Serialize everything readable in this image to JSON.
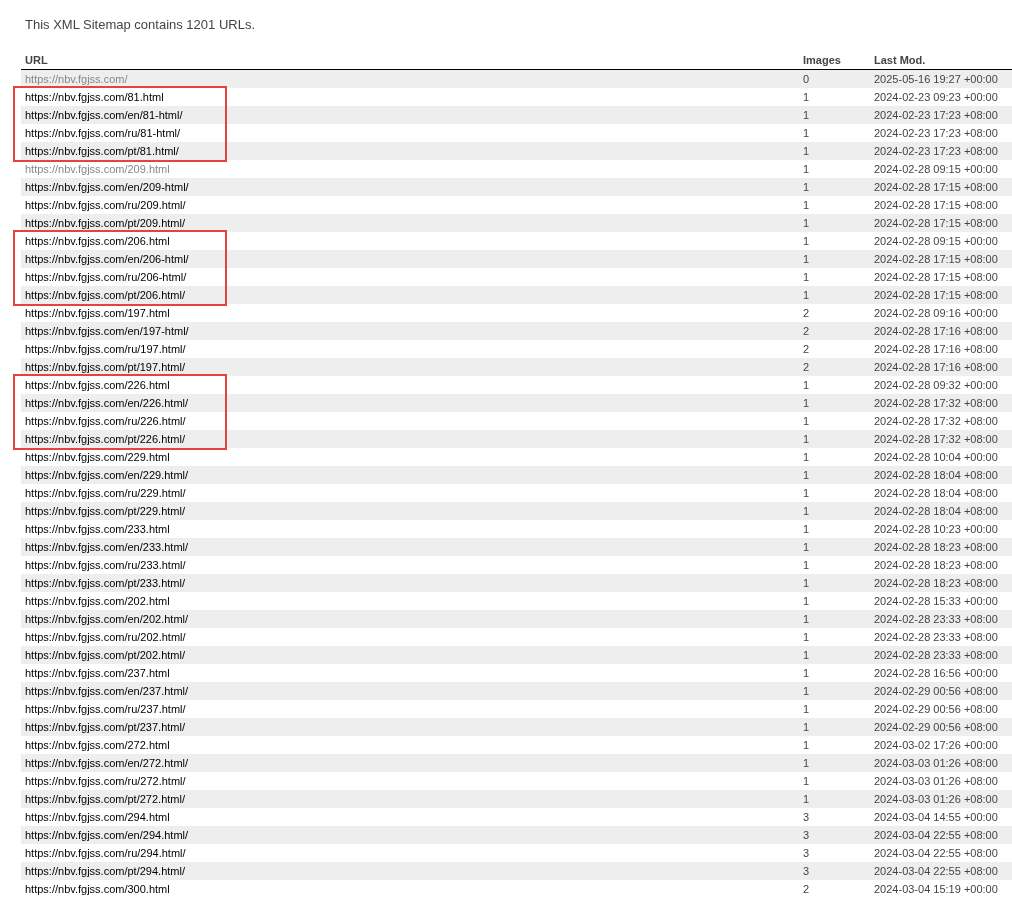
{
  "intro": "This XML Sitemap contains 1201 URLs.",
  "columns": [
    "URL",
    "Images",
    "Last Mod."
  ],
  "rows": [
    {
      "url": "https://nbv.fgjss.com/",
      "images": "0",
      "lastmod": "2025-05-16 19:27 +00:00",
      "visited": true,
      "highlighted": false
    },
    {
      "url": "https://nbv.fgjss.com/81.html",
      "images": "1",
      "lastmod": "2024-02-23 09:23 +00:00",
      "visited": false,
      "highlighted": true
    },
    {
      "url": "https://nbv.fgjss.com/en/81-html/",
      "images": "1",
      "lastmod": "2024-02-23 17:23 +08:00",
      "visited": false,
      "highlighted": true
    },
    {
      "url": "https://nbv.fgjss.com/ru/81-html/",
      "images": "1",
      "lastmod": "2024-02-23 17:23 +08:00",
      "visited": false,
      "highlighted": true
    },
    {
      "url": "https://nbv.fgjss.com/pt/81.html/",
      "images": "1",
      "lastmod": "2024-02-23 17:23 +08:00",
      "visited": false,
      "highlighted": true
    },
    {
      "url": "https://nbv.fgjss.com/209.html",
      "images": "1",
      "lastmod": "2024-02-28 09:15 +00:00",
      "visited": true,
      "highlighted": false
    },
    {
      "url": "https://nbv.fgjss.com/en/209-html/",
      "images": "1",
      "lastmod": "2024-02-28 17:15 +08:00",
      "visited": false,
      "highlighted": false
    },
    {
      "url": "https://nbv.fgjss.com/ru/209.html/",
      "images": "1",
      "lastmod": "2024-02-28 17:15 +08:00",
      "visited": false,
      "highlighted": false
    },
    {
      "url": "https://nbv.fgjss.com/pt/209.html/",
      "images": "1",
      "lastmod": "2024-02-28 17:15 +08:00",
      "visited": false,
      "highlighted": false
    },
    {
      "url": "https://nbv.fgjss.com/206.html",
      "images": "1",
      "lastmod": "2024-02-28 09:15 +00:00",
      "visited": false,
      "highlighted": true
    },
    {
      "url": "https://nbv.fgjss.com/en/206-html/",
      "images": "1",
      "lastmod": "2024-02-28 17:15 +08:00",
      "visited": false,
      "highlighted": true
    },
    {
      "url": "https://nbv.fgjss.com/ru/206-html/",
      "images": "1",
      "lastmod": "2024-02-28 17:15 +08:00",
      "visited": false,
      "highlighted": true
    },
    {
      "url": "https://nbv.fgjss.com/pt/206.html/",
      "images": "1",
      "lastmod": "2024-02-28 17:15 +08:00",
      "visited": false,
      "highlighted": true
    },
    {
      "url": "https://nbv.fgjss.com/197.html",
      "images": "2",
      "lastmod": "2024-02-28 09:16 +00:00",
      "visited": false,
      "highlighted": false
    },
    {
      "url": "https://nbv.fgjss.com/en/197-html/",
      "images": "2",
      "lastmod": "2024-02-28 17:16 +08:00",
      "visited": false,
      "highlighted": false
    },
    {
      "url": "https://nbv.fgjss.com/ru/197.html/",
      "images": "2",
      "lastmod": "2024-02-28 17:16 +08:00",
      "visited": false,
      "highlighted": false
    },
    {
      "url": "https://nbv.fgjss.com/pt/197.html/",
      "images": "2",
      "lastmod": "2024-02-28 17:16 +08:00",
      "visited": false,
      "highlighted": false
    },
    {
      "url": "https://nbv.fgjss.com/226.html",
      "images": "1",
      "lastmod": "2024-02-28 09:32 +00:00",
      "visited": false,
      "highlighted": true
    },
    {
      "url": "https://nbv.fgjss.com/en/226.html/",
      "images": "1",
      "lastmod": "2024-02-28 17:32 +08:00",
      "visited": false,
      "highlighted": true
    },
    {
      "url": "https://nbv.fgjss.com/ru/226.html/",
      "images": "1",
      "lastmod": "2024-02-28 17:32 +08:00",
      "visited": false,
      "highlighted": true
    },
    {
      "url": "https://nbv.fgjss.com/pt/226.html/",
      "images": "1",
      "lastmod": "2024-02-28 17:32 +08:00",
      "visited": false,
      "highlighted": true
    },
    {
      "url": "https://nbv.fgjss.com/229.html",
      "images": "1",
      "lastmod": "2024-02-28 10:04 +00:00",
      "visited": false,
      "highlighted": false
    },
    {
      "url": "https://nbv.fgjss.com/en/229.html/",
      "images": "1",
      "lastmod": "2024-02-28 18:04 +08:00",
      "visited": false,
      "highlighted": false
    },
    {
      "url": "https://nbv.fgjss.com/ru/229.html/",
      "images": "1",
      "lastmod": "2024-02-28 18:04 +08:00",
      "visited": false,
      "highlighted": false
    },
    {
      "url": "https://nbv.fgjss.com/pt/229.html/",
      "images": "1",
      "lastmod": "2024-02-28 18:04 +08:00",
      "visited": false,
      "highlighted": false
    },
    {
      "url": "https://nbv.fgjss.com/233.html",
      "images": "1",
      "lastmod": "2024-02-28 10:23 +00:00",
      "visited": false,
      "highlighted": false
    },
    {
      "url": "https://nbv.fgjss.com/en/233.html/",
      "images": "1",
      "lastmod": "2024-02-28 18:23 +08:00",
      "visited": false,
      "highlighted": false
    },
    {
      "url": "https://nbv.fgjss.com/ru/233.html/",
      "images": "1",
      "lastmod": "2024-02-28 18:23 +08:00",
      "visited": false,
      "highlighted": false
    },
    {
      "url": "https://nbv.fgjss.com/pt/233.html/",
      "images": "1",
      "lastmod": "2024-02-28 18:23 +08:00",
      "visited": false,
      "highlighted": false
    },
    {
      "url": "https://nbv.fgjss.com/202.html",
      "images": "1",
      "lastmod": "2024-02-28 15:33 +00:00",
      "visited": false,
      "highlighted": false
    },
    {
      "url": "https://nbv.fgjss.com/en/202.html/",
      "images": "1",
      "lastmod": "2024-02-28 23:33 +08:00",
      "visited": false,
      "highlighted": false
    },
    {
      "url": "https://nbv.fgjss.com/ru/202.html/",
      "images": "1",
      "lastmod": "2024-02-28 23:33 +08:00",
      "visited": false,
      "highlighted": false
    },
    {
      "url": "https://nbv.fgjss.com/pt/202.html/",
      "images": "1",
      "lastmod": "2024-02-28 23:33 +08:00",
      "visited": false,
      "highlighted": false
    },
    {
      "url": "https://nbv.fgjss.com/237.html",
      "images": "1",
      "lastmod": "2024-02-28 16:56 +00:00",
      "visited": false,
      "highlighted": false
    },
    {
      "url": "https://nbv.fgjss.com/en/237.html/",
      "images": "1",
      "lastmod": "2024-02-29 00:56 +08:00",
      "visited": false,
      "highlighted": false
    },
    {
      "url": "https://nbv.fgjss.com/ru/237.html/",
      "images": "1",
      "lastmod": "2024-02-29 00:56 +08:00",
      "visited": false,
      "highlighted": false
    },
    {
      "url": "https://nbv.fgjss.com/pt/237.html/",
      "images": "1",
      "lastmod": "2024-02-29 00:56 +08:00",
      "visited": false,
      "highlighted": false
    },
    {
      "url": "https://nbv.fgjss.com/272.html",
      "images": "1",
      "lastmod": "2024-03-02 17:26 +00:00",
      "visited": false,
      "highlighted": false
    },
    {
      "url": "https://nbv.fgjss.com/en/272.html/",
      "images": "1",
      "lastmod": "2024-03-03 01:26 +08:00",
      "visited": false,
      "highlighted": false
    },
    {
      "url": "https://nbv.fgjss.com/ru/272.html/",
      "images": "1",
      "lastmod": "2024-03-03 01:26 +08:00",
      "visited": false,
      "highlighted": false
    },
    {
      "url": "https://nbv.fgjss.com/pt/272.html/",
      "images": "1",
      "lastmod": "2024-03-03 01:26 +08:00",
      "visited": false,
      "highlighted": false
    },
    {
      "url": "https://nbv.fgjss.com/294.html",
      "images": "3",
      "lastmod": "2024-03-04 14:55 +00:00",
      "visited": false,
      "highlighted": false
    },
    {
      "url": "https://nbv.fgjss.com/en/294.html/",
      "images": "3",
      "lastmod": "2024-03-04 22:55 +08:00",
      "visited": false,
      "highlighted": false
    },
    {
      "url": "https://nbv.fgjss.com/ru/294.html/",
      "images": "3",
      "lastmod": "2024-03-04 22:55 +08:00",
      "visited": false,
      "highlighted": false
    },
    {
      "url": "https://nbv.fgjss.com/pt/294.html/",
      "images": "3",
      "lastmod": "2024-03-04 22:55 +08:00",
      "visited": false,
      "highlighted": false
    },
    {
      "url": "https://nbv.fgjss.com/300.html",
      "images": "2",
      "lastmod": "2024-03-04 15:19 +00:00",
      "visited": false,
      "highlighted": false
    }
  ]
}
